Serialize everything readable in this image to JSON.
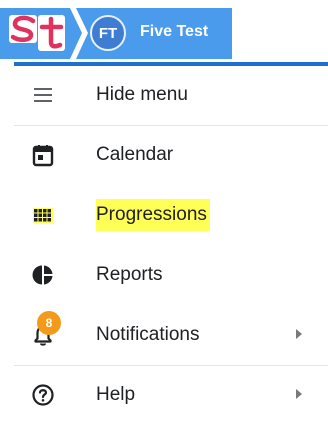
{
  "header": {
    "user_initials": "FT",
    "user_name": "Five Test"
  },
  "menu": {
    "items": [
      {
        "label": "Hide menu",
        "icon": "hamburger-icon"
      },
      {
        "label": "Calendar",
        "icon": "calendar-icon"
      },
      {
        "label": "Progressions",
        "icon": "grid-icon",
        "highlighted": true
      },
      {
        "label": "Reports",
        "icon": "pie-chart-icon"
      },
      {
        "label": "Notifications",
        "icon": "bell-icon",
        "badge": "8",
        "has_submenu": true
      },
      {
        "label": "Help",
        "icon": "help-circle-icon",
        "has_submenu": true
      }
    ]
  },
  "colors": {
    "header_blue": "#4a9bec",
    "accent_blue": "#1f6fcf",
    "highlight": "#ffff57",
    "badge_orange": "#f39a1b",
    "logo_red": "#e0325e"
  }
}
